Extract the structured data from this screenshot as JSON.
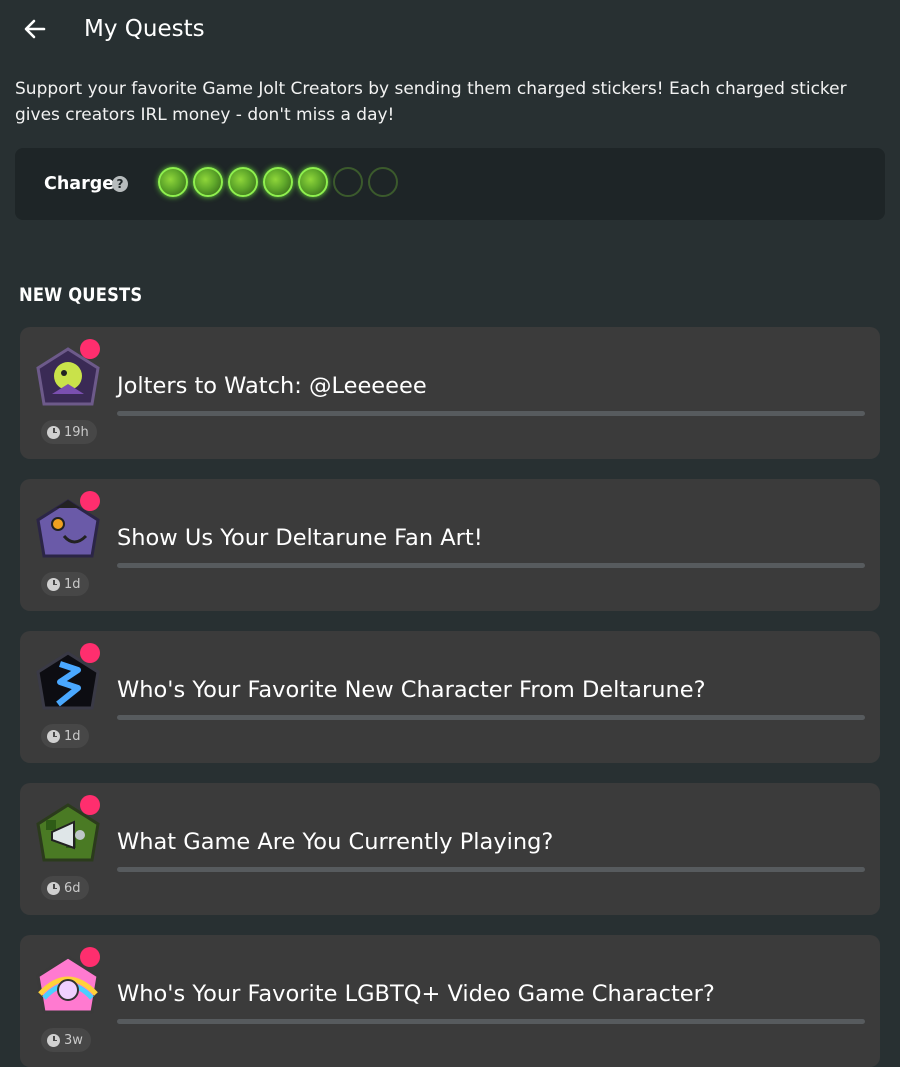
{
  "header": {
    "title": "My Quests",
    "back_icon": "arrow-left-icon"
  },
  "description": "Support your favorite Game Jolt Creators by sending them charged stickers! Each charged sticker gives creators IRL money - don't miss a day!",
  "charge": {
    "label": "Charge",
    "help_icon": "?",
    "filled": 5,
    "total": 7,
    "color": "#8ef04e"
  },
  "section": {
    "title": "NEW QUESTS"
  },
  "quests": [
    {
      "title": "Jolters to Watch: @Leeeeee",
      "time": "19h",
      "progress": 0,
      "icon": "creator-avatar-icon"
    },
    {
      "title": "Show Us Your Deltarune Fan Art!",
      "time": "1d",
      "progress": 0,
      "icon": "deltarune-character-icon"
    },
    {
      "title": "Who's Your Favorite New Character From Deltarune?",
      "time": "1d",
      "progress": 0,
      "icon": "blue-lightning-icon"
    },
    {
      "title": "What Game Are You Currently Playing?",
      "time": "6d",
      "progress": 0,
      "icon": "megaphone-icon"
    },
    {
      "title": "Who's Your Favorite LGBTQ+ Video Game Character?",
      "time": "3w",
      "progress": 0,
      "icon": "rainbow-character-icon"
    }
  ],
  "colors": {
    "background": "#283032",
    "card": "#3b3b3b",
    "new_dot": "#ff2e6e"
  }
}
